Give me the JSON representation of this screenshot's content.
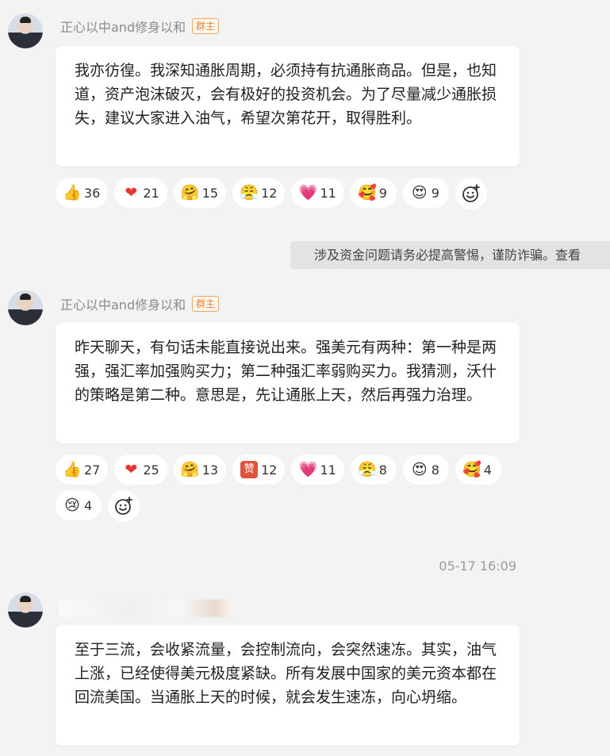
{
  "messages": [
    {
      "sender": "正心以中and修身以和",
      "badge": "群主",
      "text": "我亦彷徨。我深知通胀周期，必须持有抗通胀商品。但是，也知道，资产泡沫破灭，会有极好的投资机会。为了尽量减少通胀损失，建议大家进入油气，希望次第花开，取得胜利。",
      "reactions": [
        {
          "icon": "thumbs-up-icon",
          "glyph": "👍",
          "count": "36"
        },
        {
          "icon": "heart-icon",
          "glyph": "❤",
          "count": "21"
        },
        {
          "icon": "hug-icon",
          "glyph": "🤗",
          "count": "15"
        },
        {
          "icon": "fighting-face-icon",
          "glyph": "😤",
          "count": "12"
        },
        {
          "icon": "love-hearts-icon",
          "glyph": "💗",
          "count": "11"
        },
        {
          "icon": "flower-face-icon",
          "glyph": "🥰",
          "count": "9"
        },
        {
          "icon": "heart-eyes-face-icon",
          "glyph": "😍",
          "count": "9"
        }
      ]
    },
    {
      "sender": "正心以中and修身以和",
      "badge": "群主",
      "text": "昨天聊天，有句话未能直接说出来。强美元有两种：第一种是两强，强汇率加强购买力；第二种强汇率弱购买力。我猜测，沃什的策略是第二种。意思是，先让通胀上天，然后再强力治理。",
      "reactions": [
        {
          "icon": "thumbs-up-icon",
          "glyph": "👍",
          "count": "27"
        },
        {
          "icon": "heart-icon",
          "glyph": "❤",
          "count": "25"
        },
        {
          "icon": "hug-icon",
          "glyph": "🤗",
          "count": "13"
        },
        {
          "icon": "praise-stamp-icon",
          "glyph": "赞",
          "count": "12"
        },
        {
          "icon": "love-hearts-icon",
          "glyph": "💗",
          "count": "11"
        },
        {
          "icon": "fighting-face-icon",
          "glyph": "😤",
          "count": "8"
        },
        {
          "icon": "heart-eyes-face-icon",
          "glyph": "😍",
          "count": "8"
        },
        {
          "icon": "flower-face-icon",
          "glyph": "🥰",
          "count": "4"
        },
        {
          "icon": "crying-face-icon",
          "glyph": "😢",
          "count": "4"
        }
      ]
    },
    {
      "sender": "",
      "badge": "",
      "text": "至于三流，会收紧流量，会控制流向，会突然速冻。其实，油气上涨，已经使得美元极度紧缺。所有发展中国家的美元资本都在回流美国。当通胀上天的时候，就会发生速冻，向心坍缩。",
      "reactions": []
    }
  ],
  "notice": "涉及资金问题请务必提高警惕，谨防诈骗。查看",
  "timestamp": "05-17 16:09",
  "add_reaction_icon": "add-reaction-icon"
}
